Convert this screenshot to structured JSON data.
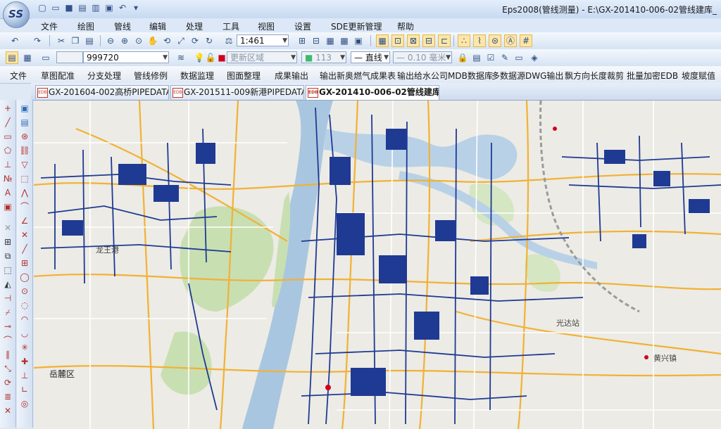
{
  "window": {
    "title": "Eps2008(管线测量) - E:\\GX-201410-006-02管线建库_"
  },
  "logo_text": "SS",
  "menu": [
    "文件",
    "绘图",
    "管线",
    "编辑",
    "处理",
    "工具",
    "视图",
    "设置",
    "SDE更新管理",
    "帮助"
  ],
  "toolbar1": {
    "scale_value": "1:461"
  },
  "toolbar2": {
    "code_value": "999720",
    "layer_value": "更新区域",
    "color_value": "113",
    "linetype_value": "直线",
    "linewidth_value": "0.10 毫米"
  },
  "toolbar3": [
    "文件",
    "草图配准",
    "分支处理",
    "管线修例",
    "数据监理",
    "图面整理",
    "成果输出",
    "输出新奥燃气成果表",
    "输出给水公司MDB数据库",
    "多数据源DWG输出",
    "飘方向长度裁剪",
    "批量加密EDB",
    "坡度赋值"
  ],
  "tabs": [
    {
      "label": "GX-201604-002高桥PIPEDATA_",
      "icon": "EDB",
      "active": false
    },
    {
      "label": "GX-201511-009新港PIPEDATA_",
      "icon": "EDB",
      "active": false
    },
    {
      "label": "GX-201410-006-02管线建库_",
      "icon": "EDB",
      "active": true
    }
  ],
  "map": {
    "labels": {
      "yuelu": "岳麓区",
      "longwang": "龙王港",
      "guangda": "光达站",
      "huangxing": "黄兴镇"
    },
    "colors": {
      "background": "#ecebe5",
      "river": "#a9c6e0",
      "pipe": "#1f3a93",
      "road_major": "#f2b134",
      "road_minor": "#ffffff",
      "green": "#c8dfb2"
    }
  },
  "icons": {
    "quick_access": [
      "new-file-icon",
      "open-folder-icon",
      "save-icon",
      "print-icon",
      "print-preview-icon",
      "export-icon",
      "undo-icon"
    ],
    "left_tools": [
      "point-icon",
      "line-icon",
      "rectangle-icon",
      "polygon-icon",
      "rotate-icon",
      "text-icon",
      "select-icon"
    ]
  }
}
